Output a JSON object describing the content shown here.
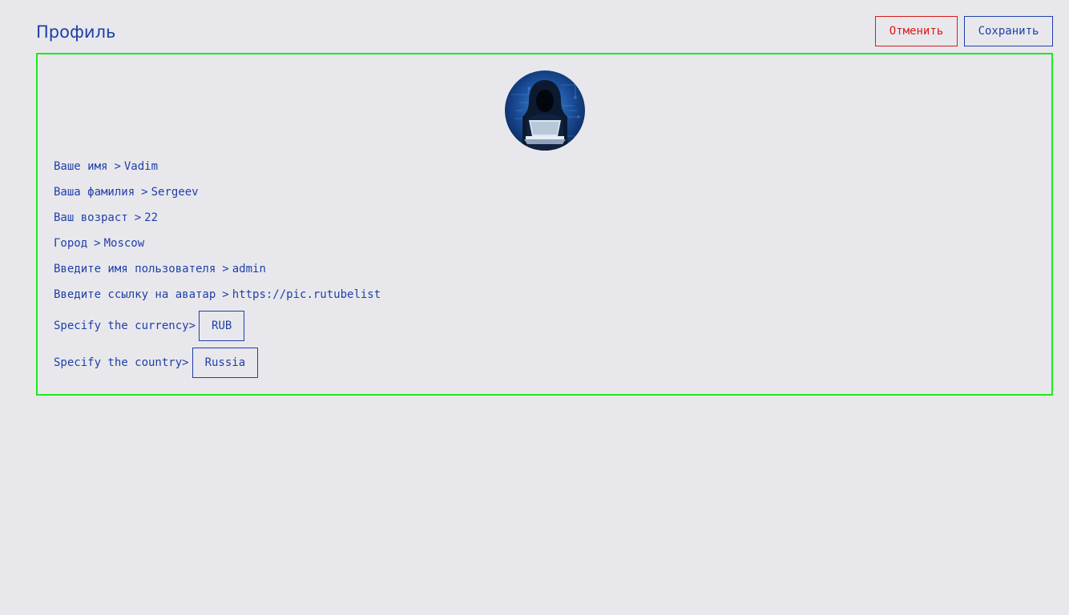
{
  "header": {
    "title": "Профиль",
    "cancel_label": "Отменить",
    "save_label": "Сохранить"
  },
  "profile": {
    "avatar": {
      "icon": "hooded-hacker-avatar"
    },
    "separator": ">",
    "fields": [
      {
        "label": "Ваше имя",
        "value": "Vadim"
      },
      {
        "label": "Ваша фамилия",
        "value": "Sergeev"
      },
      {
        "label": "Ваш возраст",
        "value": "22"
      },
      {
        "label": "Город",
        "value": "Moscow"
      },
      {
        "label": "Введите имя пользователя",
        "value": "admin"
      },
      {
        "label": "Введите ссылку на аватар",
        "value": "https://pic.rutubelist"
      }
    ],
    "currency": {
      "label": "Specify the currency>",
      "selected": "RUB"
    },
    "country": {
      "label": "Specify the country>",
      "selected": "Russia"
    }
  },
  "colors": {
    "background": "#e8e8ec",
    "primary": "#1f3fa8",
    "danger": "#d81b1b",
    "panel_border": "#1ee81e"
  }
}
